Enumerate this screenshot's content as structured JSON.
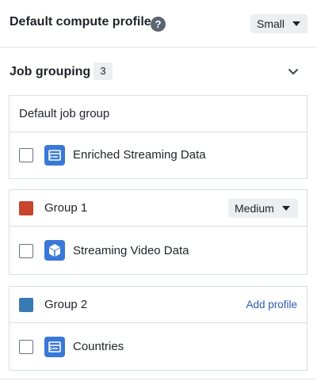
{
  "compute": {
    "title": "Default compute profile",
    "help_glyph": "?",
    "profile_value": "Small"
  },
  "job_grouping": {
    "title": "Job grouping",
    "count": "3"
  },
  "default_group": {
    "label": "Default job group",
    "items": [
      {
        "label": "Enriched Streaming Data",
        "icon": "dataset-icon"
      }
    ]
  },
  "groups": [
    {
      "label": "Group 1",
      "color": "#c8442b",
      "profile_value": "Medium",
      "items": [
        {
          "label": "Streaming Video Data",
          "icon": "cube-icon"
        }
      ]
    },
    {
      "label": "Group 2",
      "color": "#3a7ab3",
      "action_label": "Add profile",
      "items": [
        {
          "label": "Countries",
          "icon": "dataset-icon"
        }
      ]
    }
  ],
  "colors": {
    "accent_link": "#2d5bb0",
    "icon_blue": "#3a78d8"
  }
}
